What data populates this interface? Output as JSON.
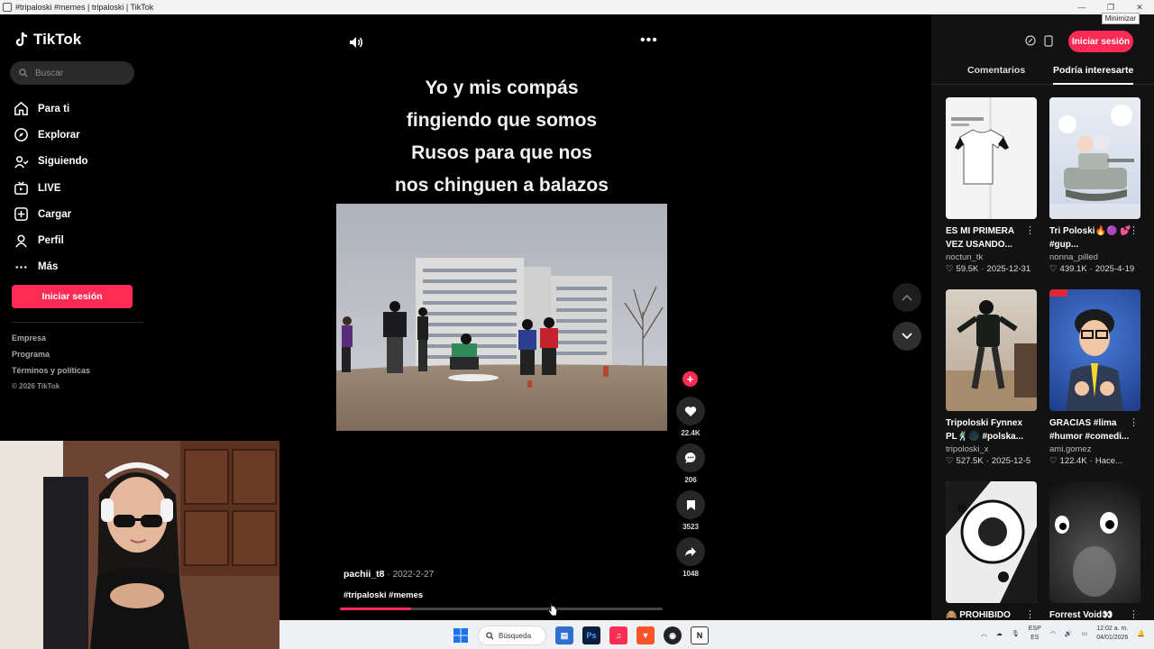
{
  "window": {
    "title": "#tripaloski #memes | tripaloski | TikTok",
    "minimize_tooltip": "Minimizar"
  },
  "sidebar": {
    "logo_text": "TikTok",
    "search_placeholder": "Buscar",
    "nav": [
      {
        "label": "Para ti",
        "icon": "home-icon"
      },
      {
        "label": "Explorar",
        "icon": "compass-icon"
      },
      {
        "label": "Siguiendo",
        "icon": "following-icon"
      },
      {
        "label": "LIVE",
        "icon": "live-icon"
      },
      {
        "label": "Cargar",
        "icon": "upload-icon"
      },
      {
        "label": "Perfil",
        "icon": "profile-icon"
      },
      {
        "label": "Más",
        "icon": "more-icon"
      }
    ],
    "login_label": "Iniciar sesión",
    "footer": [
      "Empresa",
      "Programa",
      "Términos y políticas"
    ],
    "copyright": "© 2026 TikTok"
  },
  "video": {
    "caption_lines": [
      "Yo y mis compás",
      "fingiendo que somos",
      "Rusos para que nos",
      "nos chinguen a balazos"
    ],
    "author": "pachii_t8",
    "date": "2022-2-27",
    "hashtags": "#tripaloski #memes",
    "progress": 0.22
  },
  "actions": {
    "likes": "22.4K",
    "comments": "206",
    "saves": "3523",
    "shares": "1048"
  },
  "right_panel": {
    "login_label": "Iniciar sesión",
    "tabs": [
      "Comentarios",
      "Podría interesarte"
    ],
    "active_tab": 1,
    "cards": [
      {
        "title": "ES MI PRIMERA VEZ USANDO...",
        "author": "noctun_tk",
        "likes": "59.5K",
        "date": "2025-12-31"
      },
      {
        "title": "Tri Poloski🔥🟣 💕 #gup...",
        "author": "nonna_pilled",
        "likes": "439.1K",
        "date": "2025-4-19"
      },
      {
        "title": "Tripoloski Fynnex PL🕺🌑 #polska...",
        "author": "tripoloski_x",
        "likes": "527.5K",
        "date": "2025-12-5"
      },
      {
        "title": "GRACIAS #lima #humor #comedi...",
        "author": "ami.gomez",
        "likes": "122.4K",
        "date": "Hace..."
      },
      {
        "title": "🙈 PROHIBIDO",
        "author": "",
        "likes": "",
        "date": ""
      },
      {
        "title": "Forrest Void👀",
        "author": "",
        "likes": "",
        "date": ""
      }
    ]
  },
  "taskbar": {
    "search_label": "Búsqueda",
    "lang_top": "ESP",
    "lang_bottom": "ES",
    "time": "12:02 a. m.",
    "date": "04/01/2026"
  }
}
